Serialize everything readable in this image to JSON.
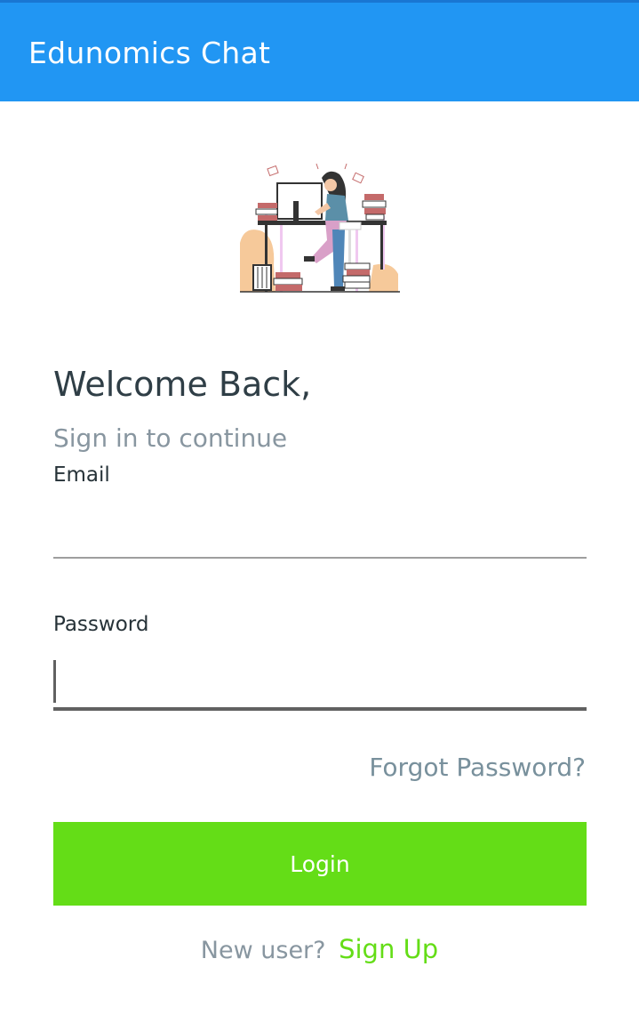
{
  "appbar": {
    "title": "Edunomics Chat",
    "background": "#2196F3"
  },
  "hero": {
    "illustration": "woman-working-at-desk-illustration"
  },
  "header": {
    "welcome": "Welcome Back,",
    "subtitle": "Sign in to continue"
  },
  "form": {
    "email_label": "Email",
    "email_value": "",
    "password_label": "Password",
    "password_value": ""
  },
  "links": {
    "forgot_password": "Forgot Password?"
  },
  "login_button": {
    "label": "Login",
    "color": "#64DD17"
  },
  "signup": {
    "prompt": "New user?",
    "link": "Sign Up"
  }
}
